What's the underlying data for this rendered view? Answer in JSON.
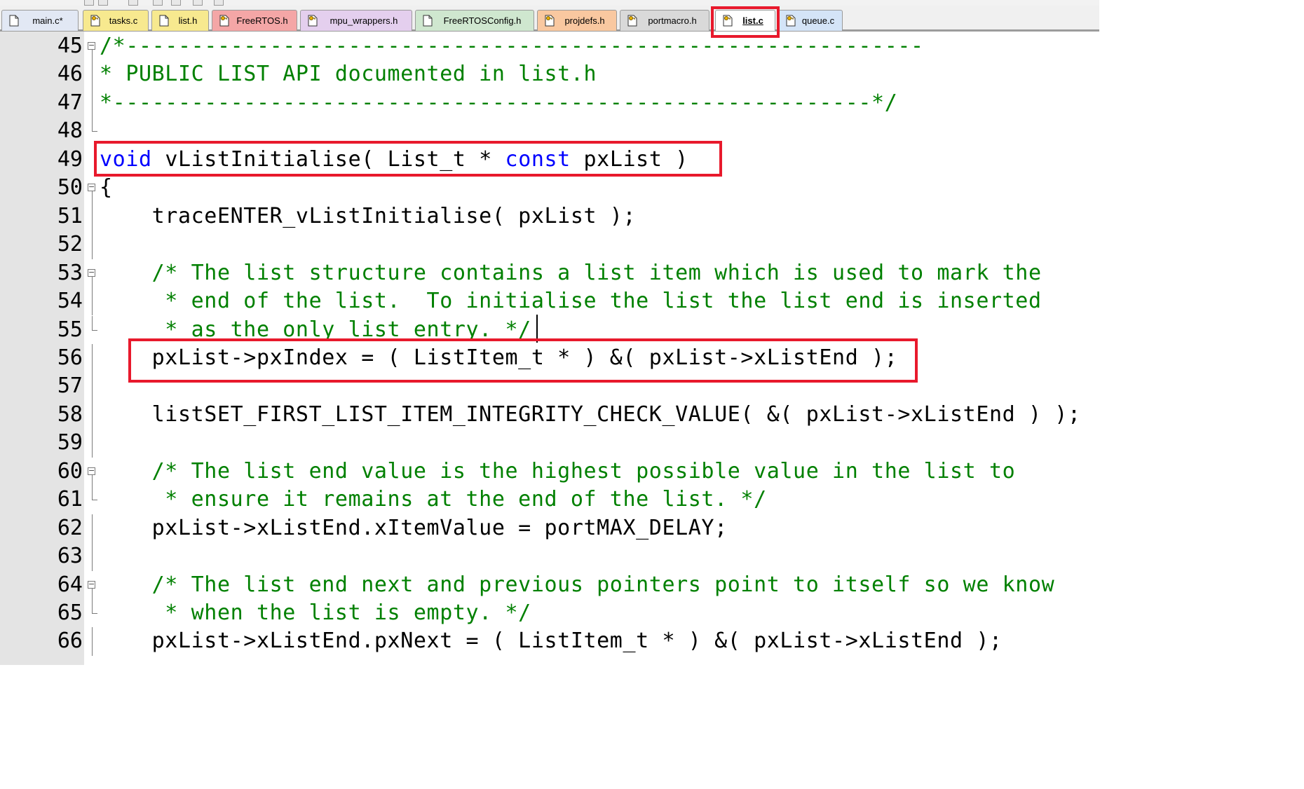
{
  "tabs": [
    {
      "label": "main.c*",
      "bg": "#e2e8f4",
      "icon": "file-icon",
      "active": false
    },
    {
      "label": "tasks.c",
      "bg": "#f7e98f",
      "icon": "key-file-icon",
      "active": false
    },
    {
      "label": "list.h",
      "bg": "#f7e98f",
      "icon": "file-icon",
      "active": false
    },
    {
      "label": "FreeRTOS.h",
      "bg": "#f4a6a6",
      "icon": "key-file-icon",
      "active": false
    },
    {
      "label": "mpu_wrappers.h",
      "bg": "#e4cfee",
      "icon": "key-file-icon",
      "active": false
    },
    {
      "label": "FreeRTOSConfig.h",
      "bg": "#cfe7cf",
      "icon": "file-icon",
      "active": false
    },
    {
      "label": "projdefs.h",
      "bg": "#f9c8a0",
      "icon": "key-file-icon",
      "active": false
    },
    {
      "label": "portmacro.h",
      "bg": "#d9d9d9",
      "icon": "key-file-icon",
      "active": false
    },
    {
      "label": "list.c",
      "bg": "#ffffff",
      "icon": "key-file-icon",
      "active": true
    },
    {
      "label": "queue.c",
      "bg": "#d4e4f7",
      "icon": "key-file-icon",
      "active": false
    }
  ],
  "editor": {
    "lines": [
      {
        "n": "45",
        "fold": "box",
        "segs": [
          {
            "t": "/*-------------------------------------------------------------",
            "c": "cmt"
          }
        ]
      },
      {
        "n": "46",
        "fold": "line",
        "segs": [
          {
            "t": "* PUBLIC LIST API documented in list.h",
            "c": "cmt"
          }
        ]
      },
      {
        "n": "47",
        "fold": "line",
        "segs": [
          {
            "t": "*----------------------------------------------------------*/",
            "c": "cmt"
          }
        ]
      },
      {
        "n": "48",
        "fold": "end",
        "segs": []
      },
      {
        "n": "49",
        "fold": "none",
        "segs": [
          {
            "t": "void",
            "c": "kw"
          },
          {
            "t": " vListInitialise( List_t * ",
            "c": ""
          },
          {
            "t": "const",
            "c": "kw"
          },
          {
            "t": " pxList )",
            "c": ""
          }
        ]
      },
      {
        "n": "50",
        "fold": "box",
        "segs": [
          {
            "t": "{",
            "c": ""
          }
        ]
      },
      {
        "n": "51",
        "fold": "line",
        "segs": [
          {
            "t": "    traceENTER_vListInitialise( pxList );",
            "c": ""
          }
        ]
      },
      {
        "n": "52",
        "fold": "line",
        "segs": []
      },
      {
        "n": "53",
        "fold": "box",
        "segs": [
          {
            "t": "    /* The list structure contains a list item which is used to mark the",
            "c": "cmt"
          }
        ]
      },
      {
        "n": "54",
        "fold": "line",
        "segs": [
          {
            "t": "     * end of the list.  To initialise the list the list end is inserted",
            "c": "cmt"
          }
        ]
      },
      {
        "n": "55",
        "fold": "end",
        "segs": [
          {
            "t": "     * as the only list entry. */",
            "c": "cmt"
          }
        ]
      },
      {
        "n": "56",
        "fold": "line",
        "segs": [
          {
            "t": "    pxList->pxIndex = ( ListItem_t * ) &( pxList->xListEnd );",
            "c": ""
          }
        ]
      },
      {
        "n": "57",
        "fold": "line",
        "segs": []
      },
      {
        "n": "58",
        "fold": "line",
        "segs": [
          {
            "t": "    listSET_FIRST_LIST_ITEM_INTEGRITY_CHECK_VALUE( &( pxList->xListEnd ) );",
            "c": ""
          }
        ]
      },
      {
        "n": "59",
        "fold": "line",
        "segs": []
      },
      {
        "n": "60",
        "fold": "box",
        "segs": [
          {
            "t": "    /* The list end value is the highest possible value in the list to",
            "c": "cmt"
          }
        ]
      },
      {
        "n": "61",
        "fold": "end",
        "segs": [
          {
            "t": "     * ensure it remains at the end of the list. */",
            "c": "cmt"
          }
        ]
      },
      {
        "n": "62",
        "fold": "line",
        "segs": [
          {
            "t": "    pxList->xListEnd.xItemValue = portMAX_DELAY;",
            "c": ""
          }
        ]
      },
      {
        "n": "63",
        "fold": "line",
        "segs": []
      },
      {
        "n": "64",
        "fold": "box",
        "segs": [
          {
            "t": "    /* The list end next and previous pointers point to itself so we know",
            "c": "cmt"
          }
        ]
      },
      {
        "n": "65",
        "fold": "end",
        "segs": [
          {
            "t": "     * when the list is empty. */",
            "c": "cmt"
          }
        ]
      },
      {
        "n": "66",
        "fold": "line",
        "segs": [
          {
            "t": "    pxList->xListEnd.pxNext = ( ListItem_t * ) &( pxList->xListEnd );",
            "c": ""
          }
        ]
      }
    ]
  },
  "highlight_color": "#e8192c",
  "comment_color": "#008000",
  "keyword_color": "#0000ff"
}
